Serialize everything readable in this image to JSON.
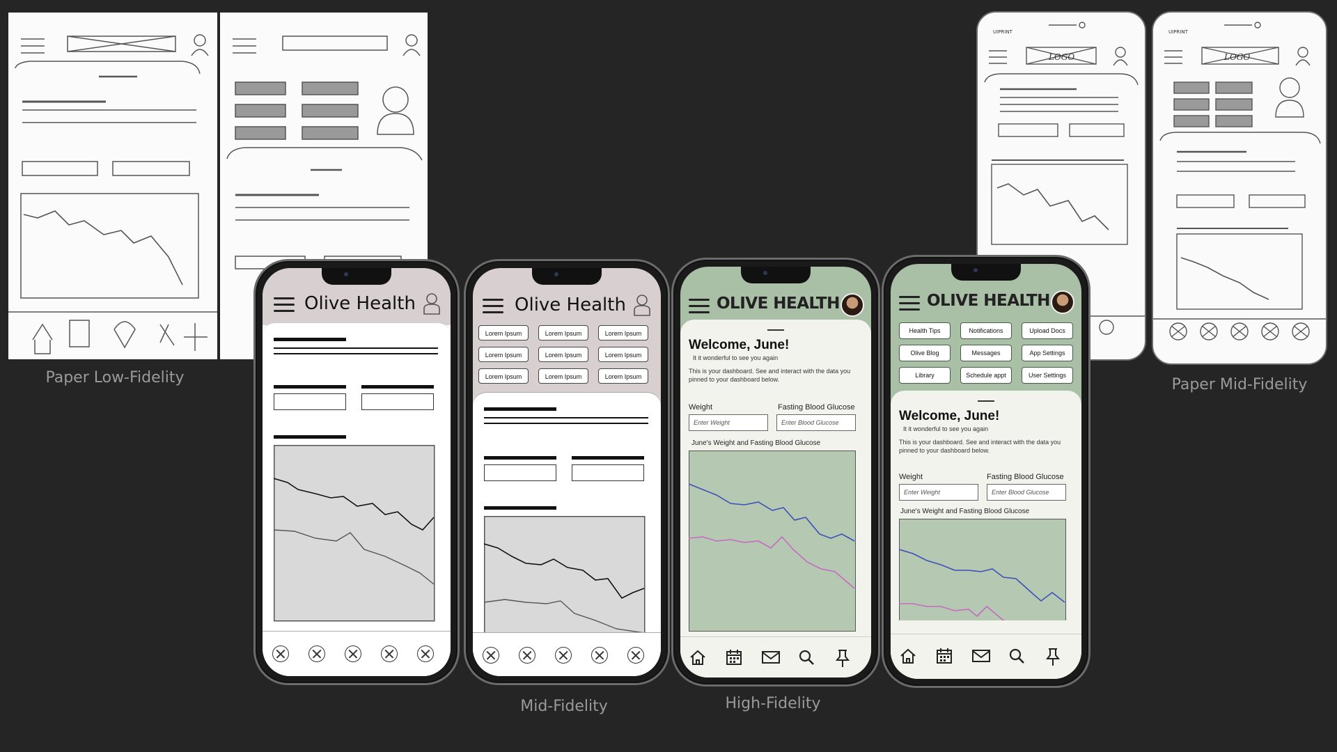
{
  "labels": {
    "paper_low": "Paper Low-Fidelity",
    "paper_mid": "Paper Mid-Fidelity",
    "mid": "Mid-Fidelity",
    "high": "High-Fidelity"
  },
  "wireframe": {
    "brand": "Olive Health",
    "button_label": "Lorem Ipsum"
  },
  "sketch": {
    "logo": "LOGO",
    "carrier": "UIPRINT"
  },
  "hifi": {
    "brand": "OLIVE HEALTH",
    "welcome": "Welcome, June!",
    "subtitle": "It it wonderful to see you again",
    "intro": "This is your dashboard. See and interact with the data you pinned to your dashboard below.",
    "weight_label": "Weight",
    "glucose_label": "Fasting Blood Glucose",
    "weight_placeholder": "Enter Weight",
    "glucose_placeholder": "Enter Blood Glucose",
    "chart_title": "June's Weight and Fasting Blood Glucose",
    "menu": [
      "Health Tips",
      "Notifications",
      "Upload Docs",
      "Olive Blog",
      "Messages",
      "App Settings",
      "Library",
      "Schedule appt",
      "User Settings"
    ],
    "nav_icons": [
      "home-icon",
      "calendar-icon",
      "mail-icon",
      "search-icon",
      "pin-icon"
    ]
  },
  "colors": {
    "background": "#252525",
    "olive": "#a9bfa6",
    "chart_bg": "#b5c9b2",
    "weight_line": "#3d4fb8",
    "glucose_line": "#c56ac0"
  }
}
